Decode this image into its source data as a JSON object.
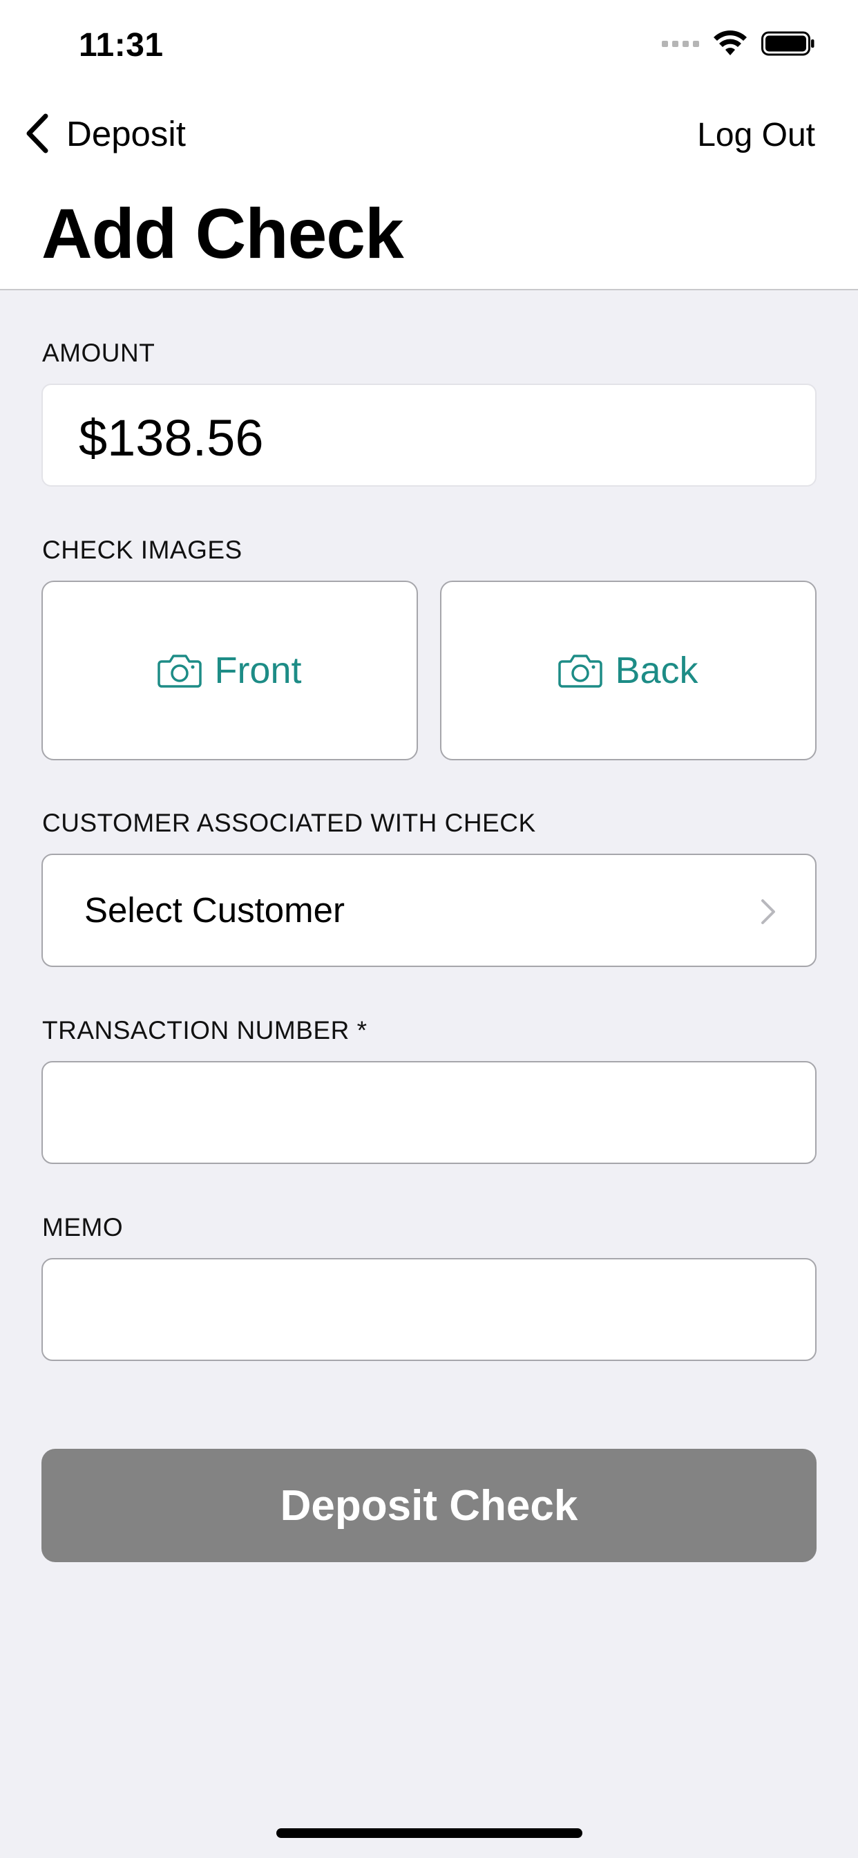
{
  "status_bar": {
    "time": "11:31"
  },
  "nav": {
    "back_label": "Deposit",
    "logout_label": "Log Out"
  },
  "page": {
    "title": "Add Check"
  },
  "amount": {
    "label": "AMOUNT",
    "value": "$138.56"
  },
  "check_images": {
    "label": "CHECK IMAGES",
    "front_label": "Front",
    "back_label": "Back",
    "icon": "camera-icon"
  },
  "customer": {
    "label": "CUSTOMER ASSOCIATED WITH CHECK",
    "placeholder": "Select Customer"
  },
  "transaction": {
    "label": "TRANSACTION NUMBER *",
    "value": ""
  },
  "memo": {
    "label": "MEMO",
    "value": ""
  },
  "submit": {
    "label": "Deposit Check"
  },
  "colors": {
    "accent": "#1d8c86",
    "button_disabled": "#838383",
    "background": "#f0f0f5"
  }
}
